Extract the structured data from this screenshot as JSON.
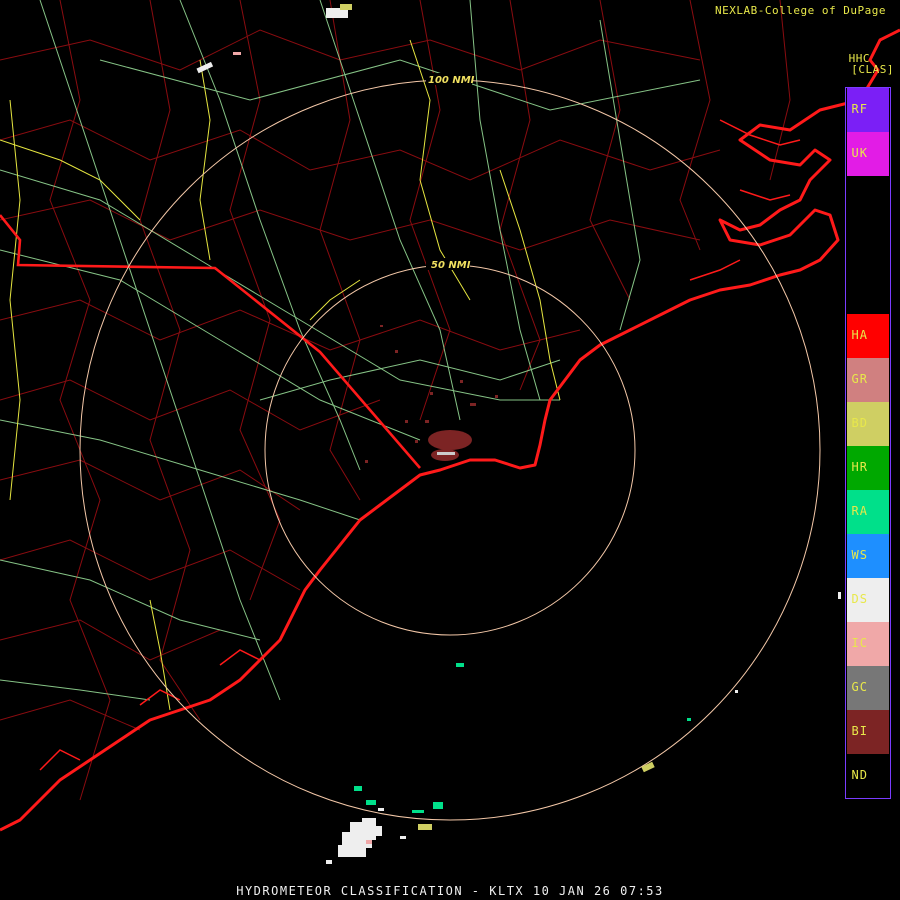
{
  "header": {
    "credit": "NEXLAB-College of DuPage",
    "product_code": "HHC",
    "classifier": "[CLAS]"
  },
  "footer": {
    "title": "HYDROMETEOR CLASSIFICATION - KLTX 10 JAN 26 07:53"
  },
  "rings": [
    {
      "label": "50 NMI"
    },
    {
      "label": "100 NMI"
    }
  ],
  "legend": [
    {
      "code": "RF",
      "color": "#7b1ff6"
    },
    {
      "code": "UK",
      "color": "#e21ce6"
    },
    {
      "code": "HA",
      "color": "#ff0000"
    },
    {
      "code": "GR",
      "color": "#d08080"
    },
    {
      "code": "BD",
      "color": "#cfcf63"
    },
    {
      "code": "HR",
      "color": "#00a800"
    },
    {
      "code": "RA",
      "color": "#00e08a"
    },
    {
      "code": "WS",
      "color": "#1e8fff"
    },
    {
      "code": "DS",
      "color": "#eeeeee"
    },
    {
      "code": "IC",
      "color": "#f0a8a8"
    },
    {
      "code": "GC",
      "color": "#777777"
    },
    {
      "code": "BI",
      "color": "#7c2424"
    },
    {
      "code": "ND",
      "color": "#000000"
    }
  ]
}
